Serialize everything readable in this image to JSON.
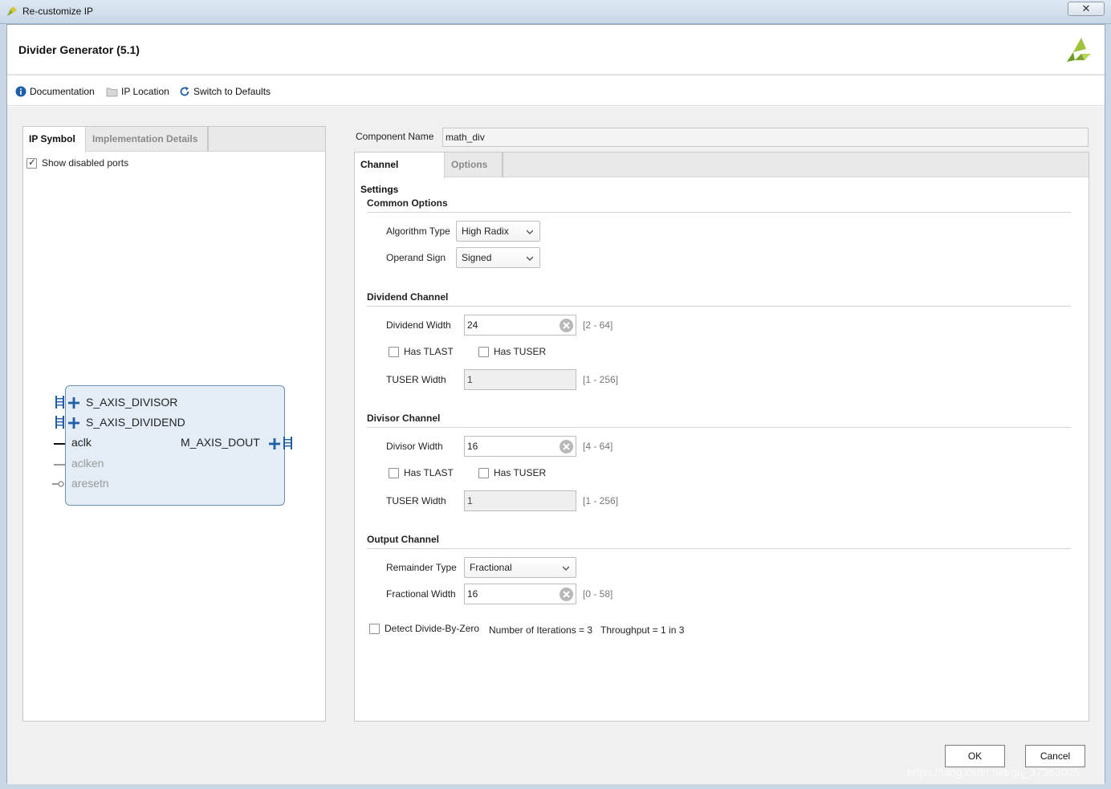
{
  "window": {
    "title": "Re-customize IP",
    "close_label": "✕"
  },
  "header": {
    "generator_title": "Divider Generator (5.1)"
  },
  "toolbar": {
    "documentation": "Documentation",
    "ip_location": "IP Location",
    "switch_defaults": "Switch to Defaults"
  },
  "left_panel": {
    "tabs": [
      "IP Symbol",
      "Implementation Details"
    ],
    "active_tab": "IP Symbol",
    "show_disabled_ports": {
      "label": "Show disabled ports",
      "checked": true
    },
    "ports": {
      "s_axis_divisor": "S_AXIS_DIVISOR",
      "s_axis_dividend": "S_AXIS_DIVIDEND",
      "aclk": "aclk",
      "aclken": "aclken",
      "aresetn": "aresetn",
      "m_axis_dout": "M_AXIS_DOUT"
    }
  },
  "component": {
    "label": "Component Name",
    "value": "math_div"
  },
  "settings_tabs": [
    "Channel Settings",
    "Options"
  ],
  "common_options": {
    "title": "Common Options",
    "algorithm_type_label": "Algorithm Type",
    "algorithm_type_value": "High Radix",
    "operand_sign_label": "Operand Sign",
    "operand_sign_value": "Signed"
  },
  "dividend_channel": {
    "title": "Dividend Channel",
    "width_label": "Dividend Width",
    "width_value": "24",
    "width_range": "[2 - 64]",
    "has_tlast": "Has TLAST",
    "has_tuser": "Has TUSER",
    "tuser_width_label": "TUSER Width",
    "tuser_width_value": "1",
    "tuser_range": "[1 - 256]"
  },
  "divisor_channel": {
    "title": "Divisor Channel",
    "width_label": "Divisor Width",
    "width_value": "16",
    "width_range": "[4 - 64]",
    "has_tlast": "Has TLAST",
    "has_tuser": "Has TUSER",
    "tuser_width_label": "TUSER Width",
    "tuser_width_value": "1",
    "tuser_range": "[1 - 256]"
  },
  "output_channel": {
    "title": "Output Channel",
    "remainder_type_label": "Remainder Type",
    "remainder_type_value": "Fractional",
    "fractional_width_label": "Fractional Width",
    "fractional_width_value": "16",
    "fractional_width_range": "[0 - 58]"
  },
  "misc": {
    "detect_divide_by_zero": "Detect Divide-By-Zero",
    "iterations": "Number of Iterations = 3",
    "throughput": "Throughput = 1 in 3"
  },
  "footer": {
    "ok": "OK",
    "cancel": "Cancel"
  },
  "watermark": "https://blog.csdn.net/qq_37363005",
  "colors": {
    "accent_blue": "#1f5fa8",
    "block_fill": "#e4edf6",
    "logo_green": "#7ca32b"
  }
}
